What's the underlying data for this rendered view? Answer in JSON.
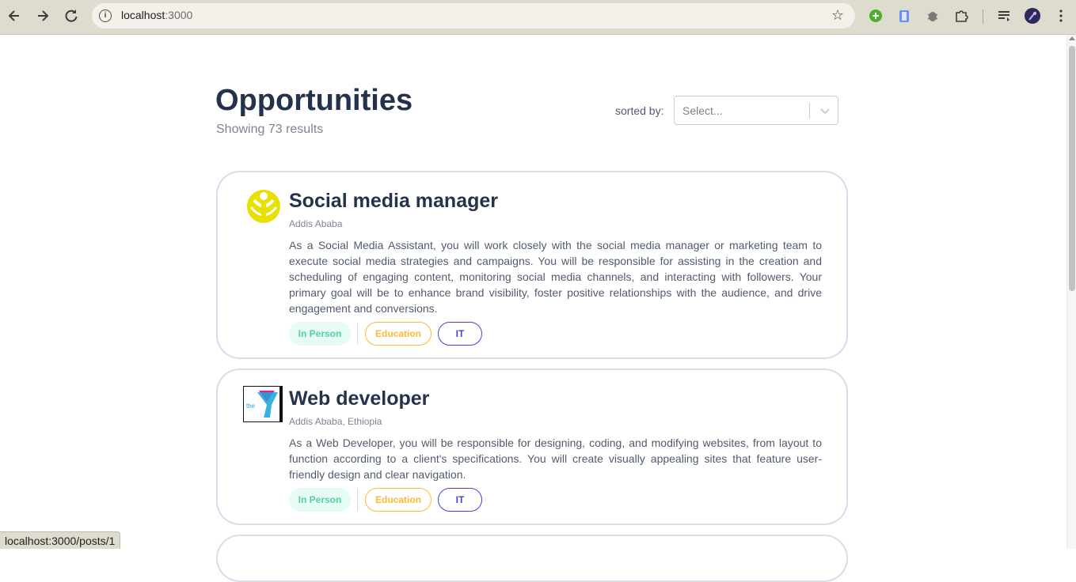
{
  "browser": {
    "url_host": "localhost",
    "url_port": ":3000",
    "back_icon": "arrow-left-icon",
    "forward_icon": "arrow-right-icon",
    "reload_icon": "reload-icon",
    "status_url": "localhost:3000/posts/1"
  },
  "header": {
    "title": "Opportunities",
    "results_text": "Showing 73 results",
    "sort_label": "sorted by:",
    "sort_placeholder": "Select..."
  },
  "posts": [
    {
      "title": "Social media manager",
      "location": "Addis Ababa",
      "description": "As a Social Media Assistant, you will work closely with the social media manager or marketing team to execute social media strategies and campaigns. You will be responsible for assisting in the creation and scheduling of engaging content, monitoring social media channels, and interacting with followers. Your primary goal will be to enhance brand visibility, foster positive relationships with the audience, and drive engagement and conversions.",
      "mode": "In Person",
      "categories": [
        "Education",
        "IT"
      ]
    },
    {
      "title": "Web developer",
      "location": "Addis Ababa, Ethiopia",
      "description": "As a Web Developer, you will be responsible for designing, coding, and modifying websites, from layout to function according to a client's specifications. You will create visually appealing sites that feature user-friendly design and clear navigation.",
      "mode": "In Person",
      "categories": [
        "Education",
        "IT"
      ],
      "logo_text": "the"
    }
  ],
  "colors": {
    "title": "#25324b",
    "muted": "#7c8493",
    "mode_bg": "#e6fbf3",
    "mode_fg": "#56cdad",
    "education": "#ffb836",
    "it": "#4640de",
    "card_border": "#d6ddeb"
  }
}
